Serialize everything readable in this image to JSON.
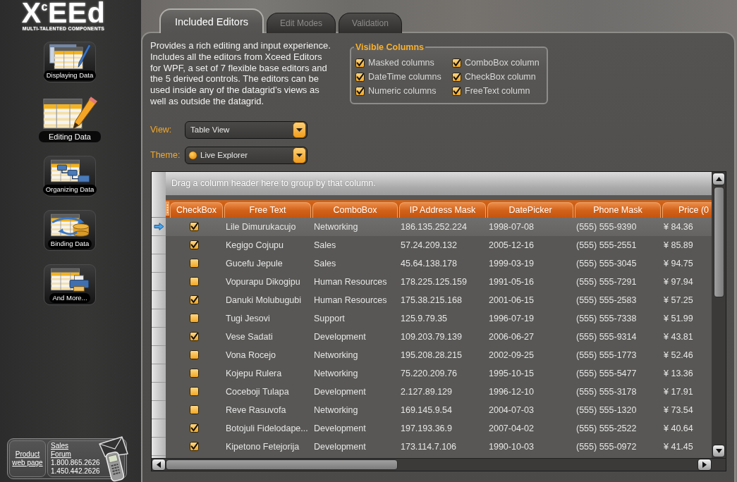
{
  "logo": {
    "text": "X$^{c}$EEd",
    "tagline": "MULTI-TALENTED COMPONENTS"
  },
  "sidebar": {
    "items": [
      {
        "label": "Displaying Data",
        "kind": "display",
        "selected": false
      },
      {
        "label": "Editing Data",
        "kind": "edit",
        "selected": true
      },
      {
        "label": "Organizing Data",
        "kind": "organize",
        "selected": false
      },
      {
        "label": "Binding Data",
        "kind": "bind",
        "selected": false
      },
      {
        "label": "And More...",
        "kind": "more",
        "selected": false
      }
    ]
  },
  "contact": {
    "product_link": "Product web page",
    "sales_link": "Sales",
    "forum_link": "Forum",
    "phones": [
      "1.800.865.2626",
      "1.450.442.2626"
    ]
  },
  "tabs": [
    {
      "label": "Included Editors",
      "selected": true
    },
    {
      "label": "Edit Modes",
      "selected": false
    },
    {
      "label": "Validation",
      "selected": false
    }
  ],
  "description": "Provides a rich editing and input experience. Includes all the editors from Xceed Editors for WPF, a set of 7 flexible base editors and the 5 derived controls. The editors can be used inside any of the datagrid’s views as well as outside the datagrid.",
  "visible_columns": {
    "title": "Visible Columns",
    "options": [
      {
        "label": "Masked columns",
        "checked": true
      },
      {
        "label": "ComboBox column",
        "checked": true
      },
      {
        "label": "DateTime columns",
        "checked": true
      },
      {
        "label": "CheckBox column",
        "checked": true
      },
      {
        "label": "Numeric columns",
        "checked": true
      },
      {
        "label": "FreeText column",
        "checked": true
      }
    ]
  },
  "view": {
    "label": "View:",
    "value": "Table View"
  },
  "theme": {
    "label": "Theme:",
    "value": "Live Explorer"
  },
  "grid": {
    "group_hint": "Drag a column header here to group by that column.",
    "columns": [
      "CheckBox",
      "Free Text",
      "ComboBox",
      "IP Address Mask",
      "DatePicker",
      "Phone Mask",
      "Price (0"
    ],
    "rows": [
      {
        "selected": true,
        "cells": [
          {
            "kind": "checkbox",
            "checked": true
          },
          "Lile Dimurukacujo",
          "Networking",
          "186.135.252.224",
          "1998-07-08",
          "(555) 555-9390",
          "¥ 84.36"
        ]
      },
      {
        "selected": false,
        "cells": [
          {
            "kind": "checkbox",
            "checked": true
          },
          "Kegigo Cojupu",
          "Sales",
          "57.24.209.132",
          "2005-12-16",
          "(555) 555-2551",
          "¥ 85.89"
        ]
      },
      {
        "selected": false,
        "cells": [
          {
            "kind": "checkbox",
            "checked": false
          },
          "Gucefu Jepule",
          "Sales",
          "45.64.138.178",
          "1999-03-19",
          "(555) 555-3045",
          "¥ 94.75"
        ]
      },
      {
        "selected": false,
        "cells": [
          {
            "kind": "checkbox",
            "checked": false
          },
          "Vopurapu Dikogipu",
          "Human Resources",
          "178.225.125.159",
          "1991-05-16",
          "(555) 555-7291",
          "¥ 97.94"
        ]
      },
      {
        "selected": false,
        "cells": [
          {
            "kind": "checkbox",
            "checked": true
          },
          "Danuki Molubugubi",
          "Human Resources",
          "175.38.215.168",
          "2001-06-15",
          "(555) 555-2583",
          "¥ 57.25"
        ]
      },
      {
        "selected": false,
        "cells": [
          {
            "kind": "checkbox",
            "checked": false
          },
          "Tugi Jesovi",
          "Support",
          "125.9.79.35",
          "1996-07-19",
          "(555) 555-7338",
          "¥ 51.99"
        ]
      },
      {
        "selected": false,
        "cells": [
          {
            "kind": "checkbox",
            "checked": true
          },
          "Vese Sadati",
          "Development",
          "109.203.79.139",
          "2006-06-27",
          "(555) 555-9314",
          "¥ 43.81"
        ]
      },
      {
        "selected": false,
        "cells": [
          {
            "kind": "checkbox",
            "checked": false
          },
          "Vona Rocejo",
          "Networking",
          "195.208.28.215",
          "2002-09-25",
          "(555) 555-1773",
          "¥ 52.46"
        ]
      },
      {
        "selected": false,
        "cells": [
          {
            "kind": "checkbox",
            "checked": false
          },
          "Kojepu Rulera",
          "Networking",
          "75.220.209.76",
          "1995-10-15",
          "(555) 555-5477",
          "¥ 13.36"
        ]
      },
      {
        "selected": false,
        "cells": [
          {
            "kind": "checkbox",
            "checked": false
          },
          "Coceboji Tulapa",
          "Development",
          "2.127.89.129",
          "1996-12-10",
          "(555) 555-3178",
          "¥ 17.91"
        ]
      },
      {
        "selected": false,
        "cells": [
          {
            "kind": "checkbox",
            "checked": false
          },
          "Reve Rasuvofa",
          "Networking",
          "169.145.9.54",
          "2004-07-03",
          "(555) 555-1320",
          "¥ 73.54"
        ]
      },
      {
        "selected": false,
        "cells": [
          {
            "kind": "checkbox",
            "checked": true
          },
          "Botojuli Fidelodape...",
          "Development",
          "197.193.36.9",
          "2007-04-02",
          "(555) 555-2522",
          "¥ 40.64"
        ]
      },
      {
        "selected": false,
        "cells": [
          {
            "kind": "checkbox",
            "checked": true
          },
          "Kipetono Fetejorija",
          "Development",
          "173.114.7.106",
          "1990-10-03",
          "(555) 555-0972",
          "¥ 41.45"
        ]
      }
    ]
  }
}
